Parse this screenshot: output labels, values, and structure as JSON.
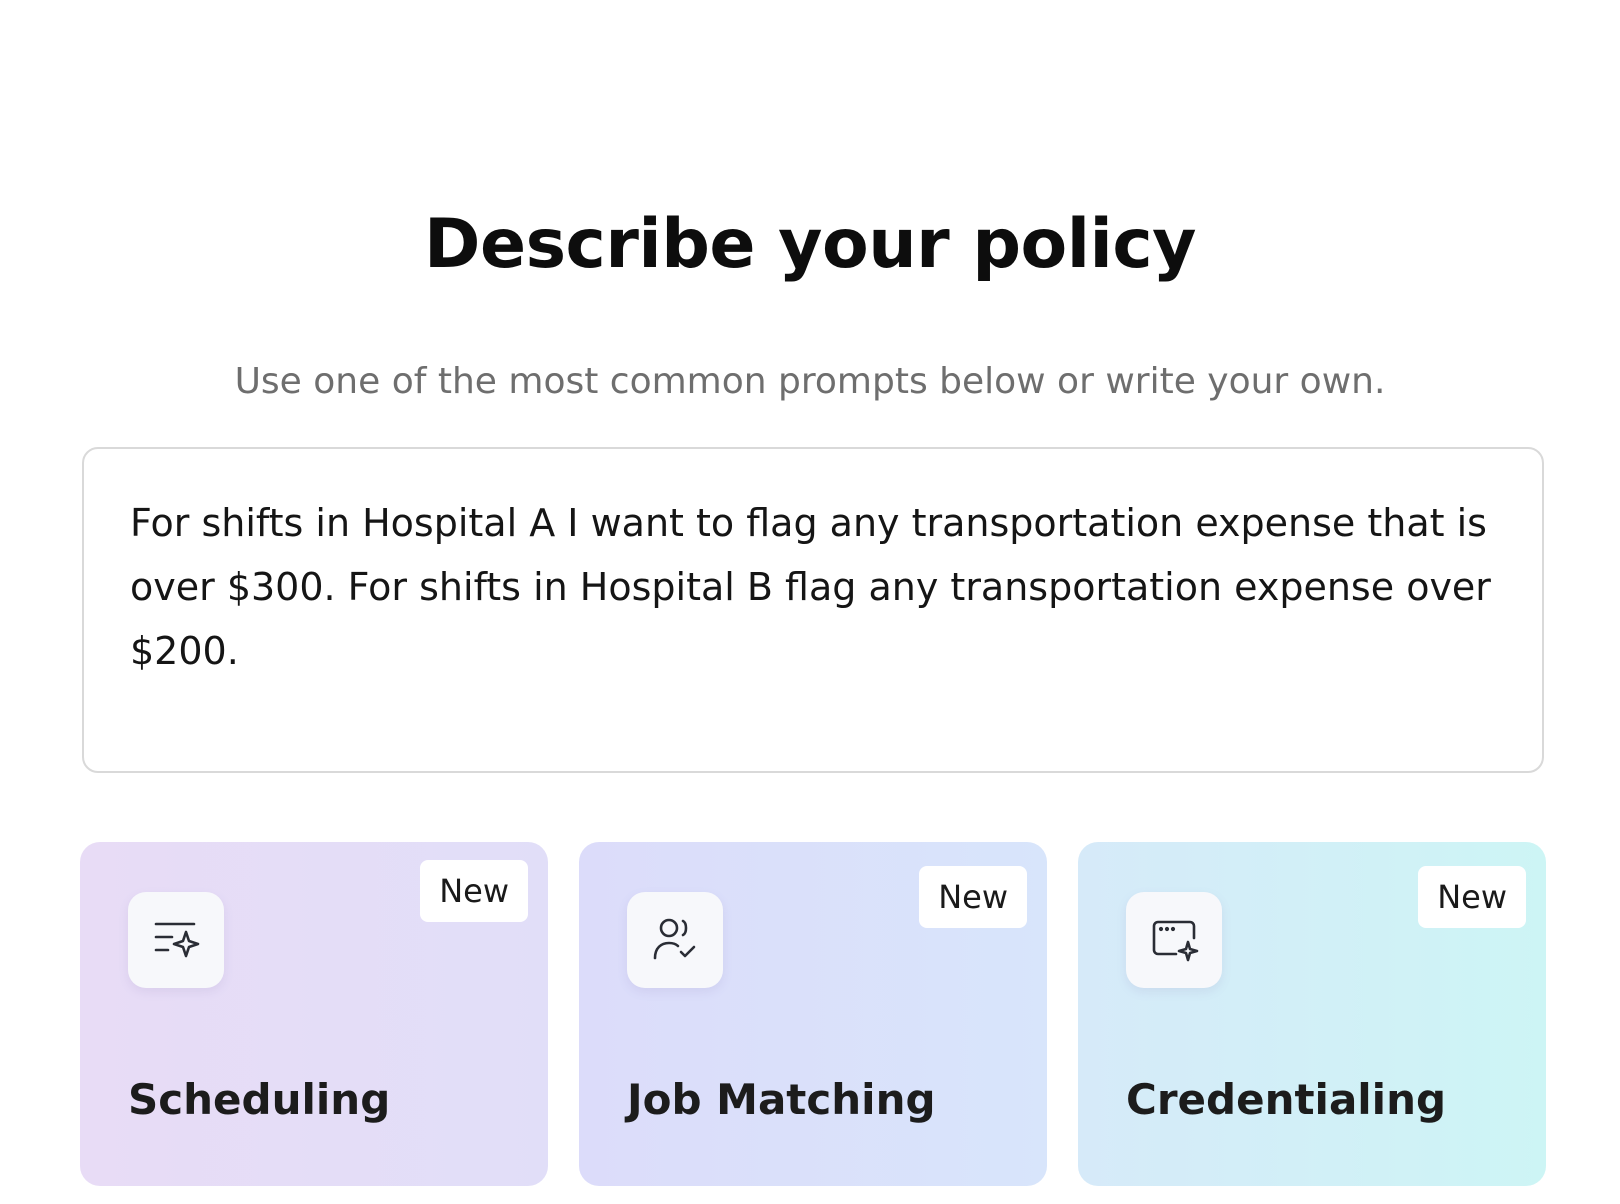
{
  "header": {
    "title": "Describe your policy",
    "subtitle": "Use one of the most common prompts below or write your own."
  },
  "prompt": {
    "value": "For shifts in Hospital A I want to flag any transportation expense that is over $300. For shifts in Hospital B flag any transportation expense over $200."
  },
  "categories": [
    {
      "label": "Scheduling",
      "badge": "New",
      "icon": "list-sparkle-icon"
    },
    {
      "label": "Job Matching",
      "badge": "New",
      "icon": "user-check-icon"
    },
    {
      "label": "Credentialing",
      "badge": "New",
      "icon": "browser-sparkle-icon"
    }
  ]
}
